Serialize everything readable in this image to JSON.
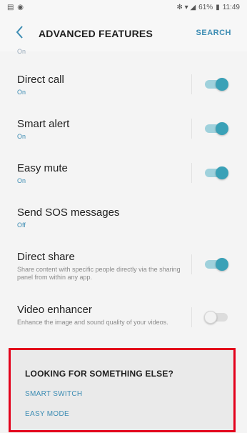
{
  "status_bar": {
    "left_icons": "▤ ◉",
    "right_icons": "✻ ▾ ◢",
    "battery": "61%",
    "time": "11:49"
  },
  "app_bar": {
    "back_icon": "chevron-left-icon",
    "title": "ADVANCED FEATURES",
    "search_label": "SEARCH"
  },
  "list": {
    "cutoff_status": "On",
    "items": [
      {
        "title": "Direct call",
        "status": "On",
        "toggle_on": true
      },
      {
        "title": "Smart alert",
        "status": "On",
        "toggle_on": true
      },
      {
        "title": "Easy mute",
        "status": "On",
        "toggle_on": true
      },
      {
        "title": "Send SOS messages",
        "status": "Off"
      },
      {
        "title": "Direct share",
        "description": "Share content with specific people directly via the sharing panel from within any app.",
        "toggle_on": true
      },
      {
        "title": "Video enhancer",
        "description": "Enhance the image and sound quality of your videos.",
        "toggle_on": false
      }
    ]
  },
  "suggestions": {
    "title": "LOOKING FOR SOMETHING ELSE?",
    "links": [
      "SMART SWITCH",
      "EASY MODE"
    ]
  },
  "colors": {
    "accent": "#3c8cb3",
    "toggle_on": "#3aa1b7",
    "highlight_border": "#e3001b"
  }
}
